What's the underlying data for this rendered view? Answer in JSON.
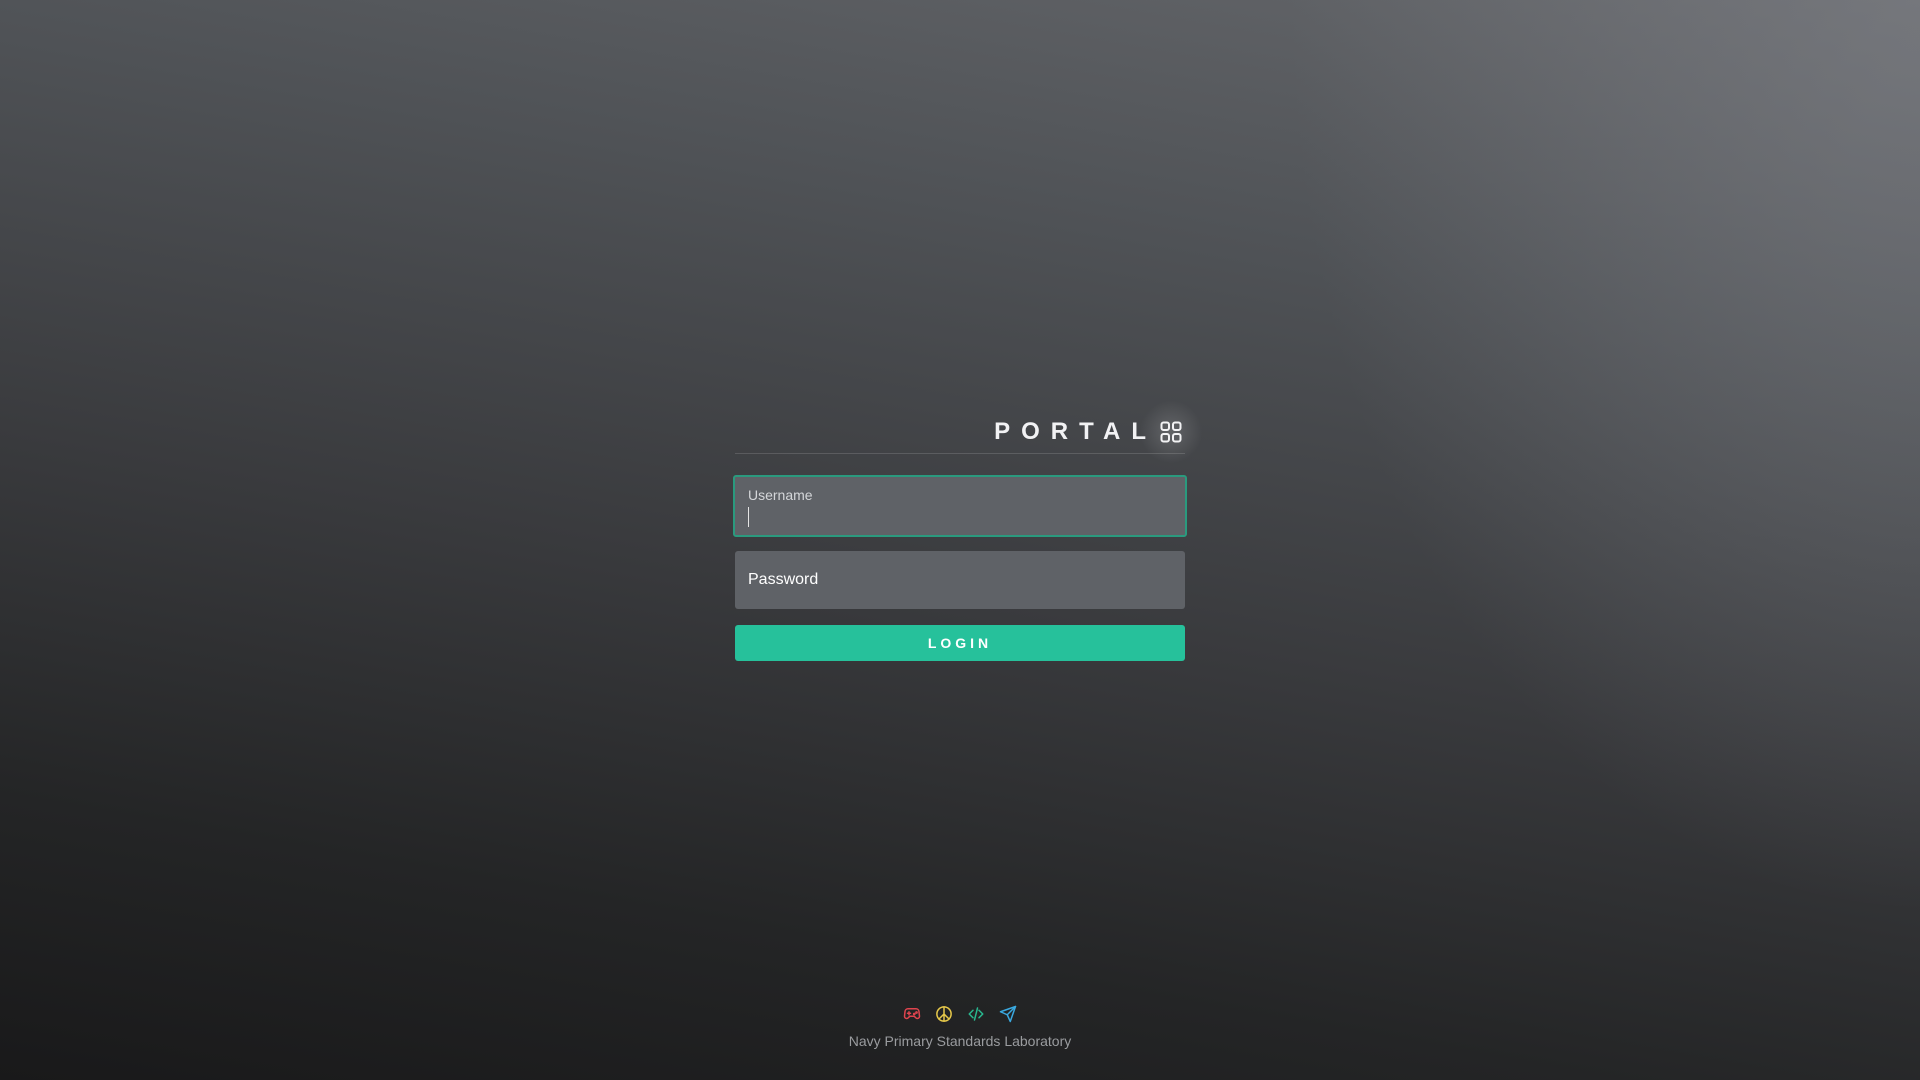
{
  "brand": {
    "title": "PORTAL",
    "icon": "grid-icon"
  },
  "login_form": {
    "username": {
      "label": "Username",
      "value": ""
    },
    "password": {
      "label": "Password",
      "value": ""
    },
    "login_button_label": "LOGIN"
  },
  "footer": {
    "icons": [
      {
        "name": "gamepad-icon",
        "color": "#e0444e"
      },
      {
        "name": "peace-icon",
        "color": "#e6c84a"
      },
      {
        "name": "code-icon",
        "color": "#29b88f"
      },
      {
        "name": "send-icon",
        "color": "#3aa9e0"
      }
    ],
    "text": "Navy Primary Standards Laboratory"
  },
  "colors": {
    "accent": "#26c19b",
    "field_focus_border": "#2a9a7e",
    "field_background": "#5f6267"
  }
}
